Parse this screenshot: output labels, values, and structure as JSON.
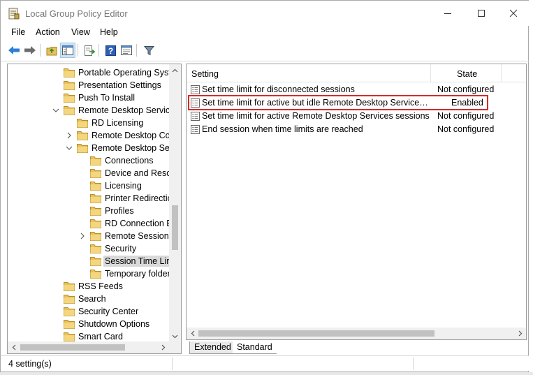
{
  "window": {
    "title": "Local Group Policy Editor"
  },
  "menu": [
    {
      "label": "File"
    },
    {
      "label": "Action"
    },
    {
      "label": "View"
    },
    {
      "label": "Help"
    }
  ],
  "toolbar": {
    "buttons": [
      "back-icon",
      "forward-icon",
      "up-folder-icon",
      "show-hide-tree-icon",
      "export-list-icon",
      "help-icon",
      "properties-icon",
      "filter-icon"
    ]
  },
  "tree": {
    "items": [
      {
        "label": "Portable Operating Syste",
        "level": 0,
        "expander": "none"
      },
      {
        "label": "Presentation Settings",
        "level": 0,
        "expander": "none"
      },
      {
        "label": "Push To Install",
        "level": 0,
        "expander": "none"
      },
      {
        "label": "Remote Desktop Services",
        "level": 0,
        "expander": "expanded"
      },
      {
        "label": "RD Licensing",
        "level": 1,
        "expander": "none"
      },
      {
        "label": "Remote Desktop Con",
        "level": 1,
        "expander": "collapsed"
      },
      {
        "label": "Remote Desktop Sess",
        "level": 1,
        "expander": "expanded"
      },
      {
        "label": "Connections",
        "level": 2,
        "expander": "none"
      },
      {
        "label": "Device and Resou",
        "level": 2,
        "expander": "none"
      },
      {
        "label": "Licensing",
        "level": 2,
        "expander": "none"
      },
      {
        "label": "Printer Redirectio",
        "level": 2,
        "expander": "none"
      },
      {
        "label": "Profiles",
        "level": 2,
        "expander": "none"
      },
      {
        "label": "RD Connection Br",
        "level": 2,
        "expander": "none"
      },
      {
        "label": "Remote Session E",
        "level": 2,
        "expander": "collapsed"
      },
      {
        "label": "Security",
        "level": 2,
        "expander": "none"
      },
      {
        "label": "Session Time Lim",
        "level": 2,
        "expander": "none",
        "selected": true
      },
      {
        "label": "Temporary folders",
        "level": 2,
        "expander": "none"
      },
      {
        "label": "RSS Feeds",
        "level": 0,
        "expander": "none"
      },
      {
        "label": "Search",
        "level": 0,
        "expander": "none"
      },
      {
        "label": "Security Center",
        "level": 0,
        "expander": "none"
      },
      {
        "label": "Shutdown Options",
        "level": 0,
        "expander": "none"
      },
      {
        "label": "Smart Card",
        "level": 0,
        "expander": "none"
      }
    ]
  },
  "list": {
    "columns": {
      "setting": "Setting",
      "state": "State"
    },
    "rows": [
      {
        "setting": "Set time limit for disconnected sessions",
        "state": "Not configured"
      },
      {
        "setting": "Set time limit for active but idle Remote Desktop Services se...",
        "state": "Enabled",
        "highlighted": true
      },
      {
        "setting": "Set time limit for active Remote Desktop Services sessions",
        "state": "Not configured"
      },
      {
        "setting": "End session when time limits are reached",
        "state": "Not configured"
      }
    ]
  },
  "tabs": [
    {
      "label": "Extended"
    },
    {
      "label": "Standard",
      "active": true
    }
  ],
  "status": {
    "text": "4 setting(s)"
  },
  "colors": {
    "highlight_box": "#d42a2a",
    "selected_tree_item": "#d9d9d9",
    "folder": "#e8c15a"
  }
}
